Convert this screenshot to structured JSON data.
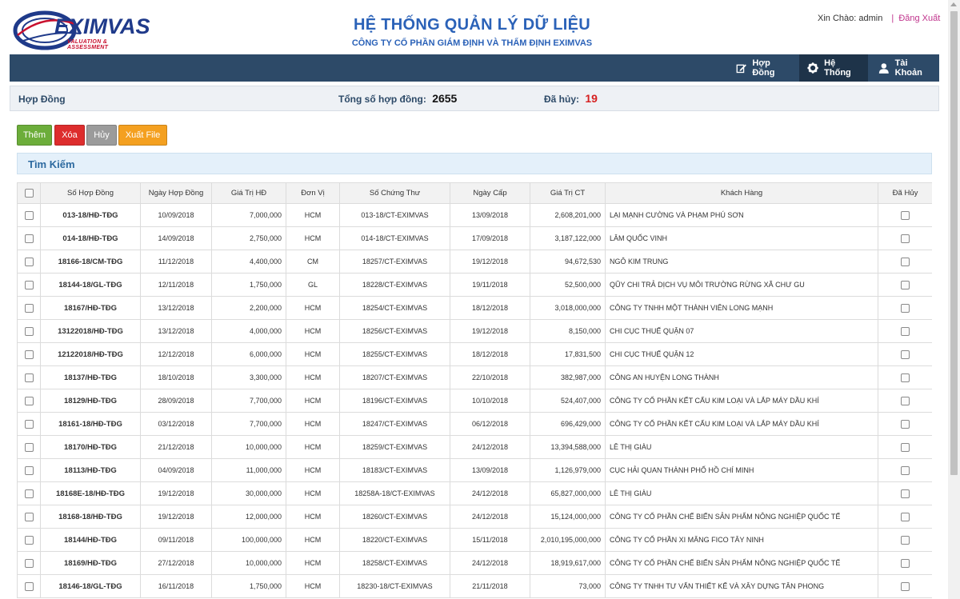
{
  "logo": {
    "text": "EXIMVAS",
    "tagline": "VALUATION & ASSESSMENT"
  },
  "header": {
    "title": "HỆ THỐNG QUẢN LÝ DỮ LIỆU",
    "subtitle": "CÔNG TY CỔ PHẦN GIÁM ĐỊNH VÀ THẨM ĐỊNH EXIMVAS",
    "greeting": "Xin Chào: admin",
    "separator": "|",
    "logout": "Đăng Xuất"
  },
  "nav": {
    "contracts": "Hợp Đồng",
    "system": "Hệ Thống",
    "account": "Tài Khoản"
  },
  "summary": {
    "section": "Hợp Đồng",
    "total_label": "Tổng số hợp đồng:",
    "total_value": "2655",
    "cancelled_label": "Đã hủy:",
    "cancelled_value": "19"
  },
  "toolbar": {
    "add": "Thêm",
    "delete": "Xóa",
    "cancel": "Hủy",
    "export": "Xuất File"
  },
  "search": {
    "title": "Tìm Kiếm"
  },
  "colors": {
    "nav_bg": "#2d4a68",
    "title": "#2b62b8",
    "cancelled": "#d62020"
  },
  "table": {
    "headers": [
      "Số Hợp Đồng",
      "Ngày Hợp Đồng",
      "Giá Trị HĐ",
      "Đơn Vị",
      "Số Chứng Thư",
      "Ngày Cấp",
      "Giá Trị CT",
      "Khách Hàng",
      "Đã Hủy"
    ],
    "rows": [
      [
        "013-18/HĐ-TĐG",
        "10/09/2018",
        "7,000,000",
        "HCM",
        "013-18/CT-EXIMVAS",
        "13/09/2018",
        "2,608,201,000",
        "LẠI MẠNH CƯỜNG VÀ PHẠM PHÚ SƠN"
      ],
      [
        "014-18/HĐ-TĐG",
        "14/09/2018",
        "2,750,000",
        "HCM",
        "014-18/CT-EXIMVAS",
        "17/09/2018",
        "3,187,122,000",
        "LÂM QUỐC VINH"
      ],
      [
        "18166-18/CM-TĐG",
        "11/12/2018",
        "4,400,000",
        "CM",
        "18257/CT-EXIMVAS",
        "19/12/2018",
        "94,672,530",
        "NGÔ KIM TRUNG"
      ],
      [
        "18144-18/GL-TĐG",
        "12/11/2018",
        "1,750,000",
        "GL",
        "18228/CT-EXIMVAS",
        "19/11/2018",
        "52,500,000",
        "QŨY CHI TRẢ DỊCH VỤ MÔI TRƯỜNG RỪNG XÃ CHƯ GU"
      ],
      [
        "18167/HĐ-TĐG",
        "13/12/2018",
        "2,200,000",
        "HCM",
        "18254/CT-EXIMVAS",
        "18/12/2018",
        "3,018,000,000",
        "CÔNG TY TNHH MỘT THÀNH VIÊN LONG MẠNH"
      ],
      [
        "13122018/HĐ-TĐG",
        "13/12/2018",
        "4,000,000",
        "HCM",
        "18256/CT-EXIMVAS",
        "19/12/2018",
        "8,150,000",
        "CHI CỤC THUẾ QUẬN 07"
      ],
      [
        "12122018/HĐ-TĐG",
        "12/12/2018",
        "6,000,000",
        "HCM",
        "18255/CT-EXIMVAS",
        "18/12/2018",
        "17,831,500",
        "CHI CỤC THUẾ QUẬN 12"
      ],
      [
        "18137/HĐ-TĐG",
        "18/10/2018",
        "3,300,000",
        "HCM",
        "18207/CT-EXIMVAS",
        "22/10/2018",
        "382,987,000",
        "CÔNG AN HUYỆN LONG THÀNH"
      ],
      [
        "18129/HĐ-TĐG",
        "28/09/2018",
        "7,700,000",
        "HCM",
        "18196/CT-EXIMVAS",
        "10/10/2018",
        "524,407,000",
        "CÔNG TY CỔ PHẦN KẾT CẤU KIM LOẠI VÀ LẮP MÁY DẦU KHÍ"
      ],
      [
        "18161-18/HĐ-TĐG",
        "03/12/2018",
        "7,700,000",
        "HCM",
        "18247/CT-EXIMVAS",
        "06/12/2018",
        "696,429,000",
        "CÔNG TY CỔ PHẦN KẾT CẤU KIM LOẠI VÀ LẮP MÁY DẦU KHÍ"
      ],
      [
        "18170/HĐ-TĐG",
        "21/12/2018",
        "10,000,000",
        "HCM",
        "18259/CT-EXIMVAS",
        "24/12/2018",
        "13,394,588,000",
        "LÊ THỊ GIÀU"
      ],
      [
        "18113/HĐ-TĐG",
        "04/09/2018",
        "11,000,000",
        "HCM",
        "18183/CT-EXIMVAS",
        "13/09/2018",
        "1,126,979,000",
        "CỤC HẢI QUAN THÀNH PHỐ HỒ CHÍ MINH"
      ],
      [
        "18168E-18/HĐ-TĐG",
        "19/12/2018",
        "30,000,000",
        "HCM",
        "18258A-18/CT-EXIMVAS",
        "24/12/2018",
        "65,827,000,000",
        "LÊ THỊ GIÀU"
      ],
      [
        "18168-18/HĐ-TĐG",
        "19/12/2018",
        "12,000,000",
        "HCM",
        "18260/CT-EXIMVAS",
        "24/12/2018",
        "15,124,000,000",
        "CÔNG TY CỔ PHẦN CHẾ BIẾN SẢN PHẨM NÔNG NGHIỆP QUỐC TẾ"
      ],
      [
        "18144/HĐ-TĐG",
        "09/11/2018",
        "100,000,000",
        "HCM",
        "18220/CT-EXIMVAS",
        "15/11/2018",
        "2,010,195,000,000",
        "CÔNG TY CỔ PHẦN XI MĂNG FICO TÂY NINH"
      ],
      [
        "18169/HĐ-TĐG",
        "27/12/2018",
        "10,000,000",
        "HCM",
        "18258/CT-EXIMVAS",
        "24/12/2018",
        "18,919,617,000",
        "CÔNG TY CỔ PHẦN CHẾ BIẾN SẢN PHẨM NÔNG NGHIỆP QUỐC TẾ"
      ],
      [
        "18146-18/GL-TĐG",
        "16/11/2018",
        "1,750,000",
        "HCM",
        "18230-18/CT-EXIMVAS",
        "21/11/2018",
        "73,000",
        "CÔNG TY TNHH TƯ VẤN THIẾT KẾ VÀ XÂY DỰNG TÂN PHONG"
      ]
    ]
  }
}
